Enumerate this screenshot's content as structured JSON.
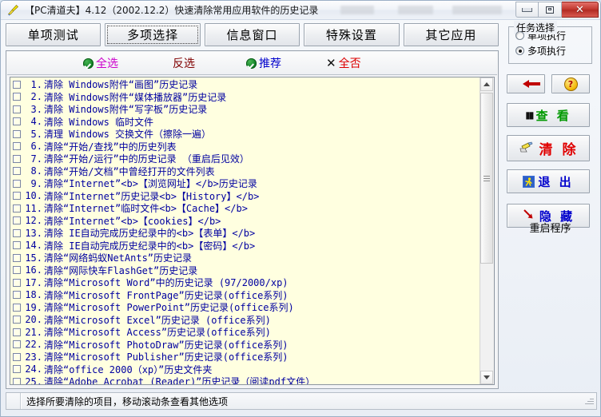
{
  "window": {
    "title": "【PC清道夫】4.12（2002.12.2）快速清除常用应用软件的历史记录",
    "app_icon": "broom-icon",
    "minimize_label": "",
    "restore_label": "",
    "close_label": "✕"
  },
  "tabs": [
    {
      "label": "单项测试",
      "selected": false
    },
    {
      "label": "多项选择",
      "selected": true
    },
    {
      "label": "信息窗口",
      "selected": false
    },
    {
      "label": "特殊设置",
      "selected": false
    },
    {
      "label": "其它应用",
      "selected": false
    }
  ],
  "toolbar": {
    "items": [
      {
        "label": "全选",
        "icon": "green-check-icon",
        "color": "#cc00cc"
      },
      {
        "label": "反选",
        "icon": "none",
        "color": "#800000"
      },
      {
        "label": "推荐",
        "icon": "green-check-icon",
        "color": "#0000cc"
      },
      {
        "label": "全否",
        "icon": "x-mark-icon",
        "color": "#dd0000"
      }
    ]
  },
  "list": {
    "rows": [
      {
        "num": "1.",
        "text": "清除 Windows附件“画图”历史记录",
        "checked": false
      },
      {
        "num": "2.",
        "text": "清除 Windows附件“媒体播放器”历史记录",
        "checked": false
      },
      {
        "num": "3.",
        "text": "清除 Windows附件“写字板”历史记录",
        "checked": false
      },
      {
        "num": "4.",
        "text": "清除 Windows 临时文件",
        "checked": false
      },
      {
        "num": "5.",
        "text": "清理 Windows 交换文件（擦除一遍）",
        "checked": false
      },
      {
        "num": "6.",
        "text": "清除“开始/查找”中的历史列表",
        "checked": false
      },
      {
        "num": "7.",
        "text": "清除“开始/运行”中的历史记录 （重启后见效）",
        "checked": false
      },
      {
        "num": "8.",
        "text": "清除“开始/文档”中曾经打开的文件列表",
        "checked": false
      },
      {
        "num": "9.",
        "text": "清除“Internet”【浏览网址】历史记录",
        "checked": false
      },
      {
        "num": "10.",
        "text": "清除“Internet”历史记录【History】",
        "checked": false
      },
      {
        "num": "11.",
        "text": "清除“Internet”临时文件【Cache】",
        "checked": false
      },
      {
        "num": "12.",
        "text": "清除“Internet”【cookies】",
        "checked": false
      },
      {
        "num": "13.",
        "text": "清除 IE自动完成历史纪录中的【表单】",
        "checked": false
      },
      {
        "num": "14.",
        "text": "清除 IE自动完成历史纪录中的【密码】",
        "checked": false
      },
      {
        "num": "15.",
        "text": "清除“网络蚂蚁NetAnts”历史记录",
        "checked": false
      },
      {
        "num": "16.",
        "text": "清除“网际快车FlashGet”历史记录",
        "checked": false
      },
      {
        "num": "17.",
        "text": "清除“Microsoft Word”中的历史记录 (97/2000/xp)",
        "checked": false
      },
      {
        "num": "18.",
        "text": "清除“Microsoft FrontPage”历史记录(office系列)",
        "checked": false
      },
      {
        "num": "19.",
        "text": "清除“Microsoft PowerPoint”历史记录(office系列)",
        "checked": false
      },
      {
        "num": "20.",
        "text": "清除“Microsoft Excel”历史记录 (office系列)",
        "checked": false
      },
      {
        "num": "21.",
        "text": "清除“Microsoft Access”历史记录(office系列)",
        "checked": false
      },
      {
        "num": "22.",
        "text": "清除“Microsoft PhotoDraw”历史记录(office系列)",
        "checked": false
      },
      {
        "num": "23.",
        "text": "清除“Microsoft Publisher”历史记录(office系列)",
        "checked": false
      },
      {
        "num": "24.",
        "text": "清除“office 2000（xp）”历史文件夹",
        "checked": false
      },
      {
        "num": "25.",
        "text": "清除“Adobe Acrobat (Reader)”历史记录（阅读pdf文件）",
        "checked": false
      }
    ]
  },
  "right_panel": {
    "group_title": "任务选择",
    "radios": [
      {
        "label": "单项执行",
        "selected": false
      },
      {
        "label": "多项执行",
        "selected": true
      }
    ],
    "back_button": {
      "label": "",
      "icon": "red-left-arrow-icon"
    },
    "help_button": {
      "label": "?",
      "icon": "question-mark-icon"
    },
    "buttons": [
      {
        "label": "查 看",
        "icon": "binoculars-icon"
      },
      {
        "label": "清 除",
        "icon": "brush-icon"
      },
      {
        "label": "退 出",
        "icon": "running-man-icon"
      },
      {
        "label": "隐 藏",
        "icon": "down-right-arrow-icon"
      }
    ],
    "restart_text": "重启程序"
  },
  "statusbar": {
    "message": "选择所要清除的项目，移动滚动条查看其他选项"
  },
  "scrollbar": {
    "up_arrow": "scroll-up-icon",
    "down_arrow": "scroll-down-icon"
  }
}
